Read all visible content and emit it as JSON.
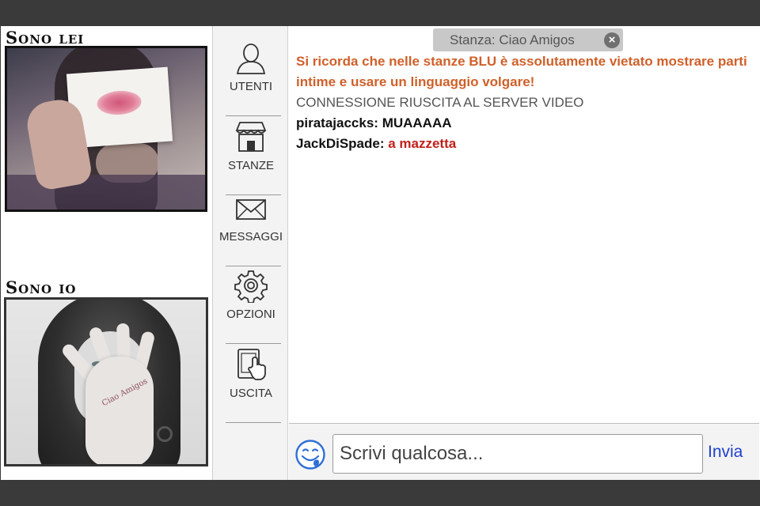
{
  "videos": {
    "remote_title": "Sono lei",
    "local_title": "Sono io",
    "local_palm_text": "Ciao Amigos"
  },
  "nav": {
    "items": [
      {
        "label": "UTENTI",
        "icon": "user-icon"
      },
      {
        "label": "STANZE",
        "icon": "store-icon"
      },
      {
        "label": "MESSAGGI",
        "icon": "envelope-icon"
      },
      {
        "label": "OPZIONI",
        "icon": "gear-icon"
      },
      {
        "label": "USCITA",
        "icon": "exit-tablet-icon"
      }
    ]
  },
  "room": {
    "label": "Stanza: Ciao Amigos",
    "close_glyph": "×"
  },
  "messages": {
    "warning": "Si ricorda che nelle stanze BLU è assolutamente vietato mostrare parti intime e usare un linguaggio volgare!",
    "system": "CONNESSIONE RIUSCITA AL  SERVER VIDEO",
    "chat": [
      {
        "user": "piratajaccks:",
        "text": "MUAAAAA"
      },
      {
        "user": "JackDiSpade:",
        "text": "a mazzetta"
      }
    ]
  },
  "composer": {
    "placeholder": "Scrivi qualcosa...",
    "send_label": "Invia"
  },
  "colors": {
    "warning": "#d0602a",
    "link_blue": "#1f3fd0",
    "highlight_red": "#c0201a"
  }
}
